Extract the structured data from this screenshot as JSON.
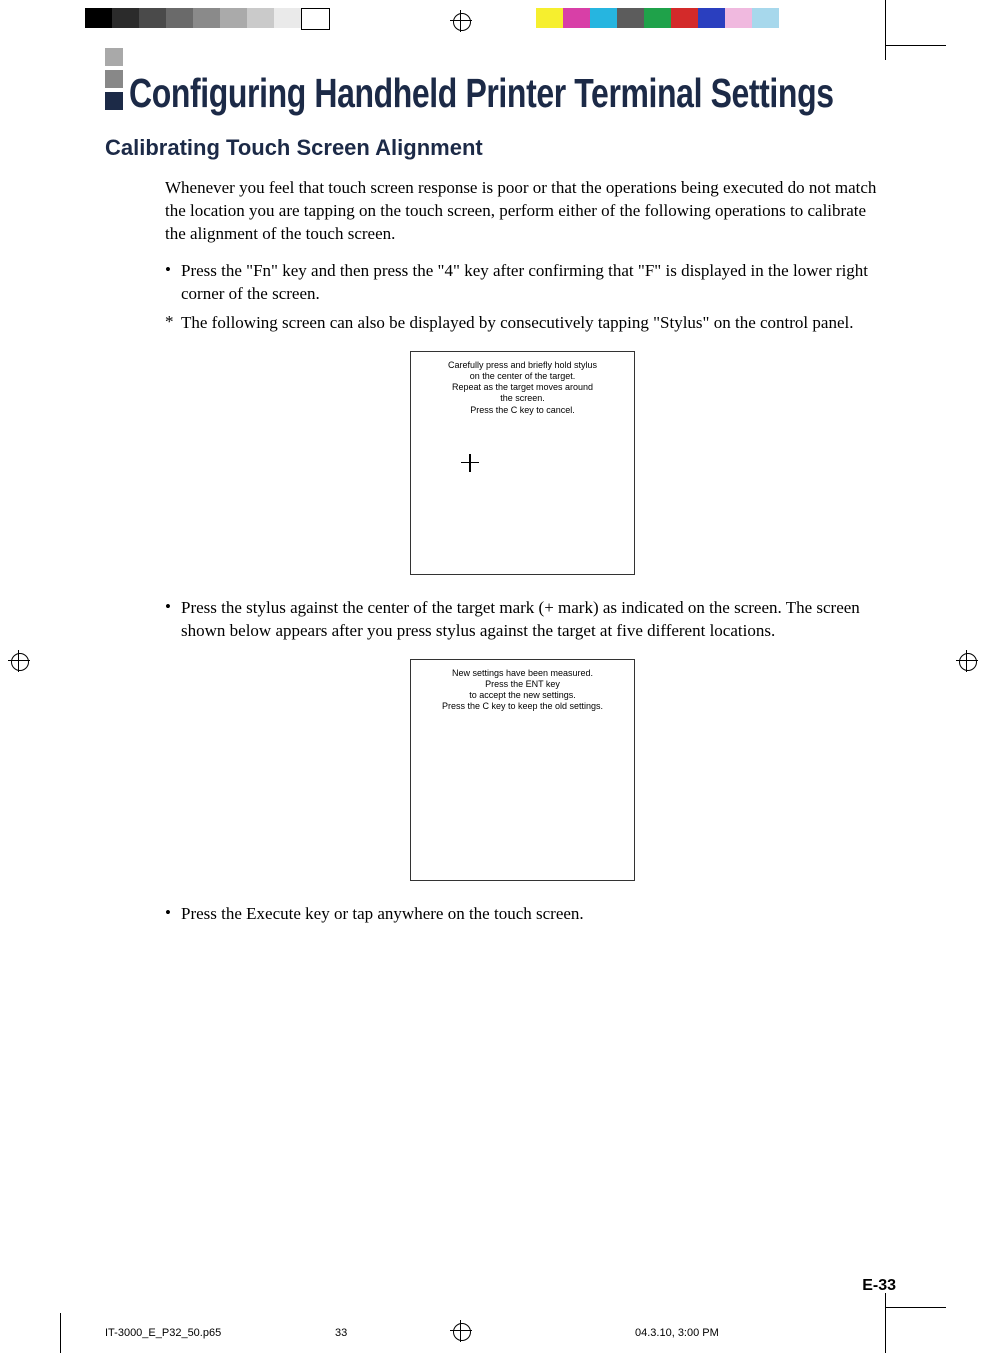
{
  "colorbar_left": [
    "#000000",
    "#2b2b2b",
    "#4a4a4a",
    "#6a6a6a",
    "#8a8a8a",
    "#aaaaaa",
    "#cacaca",
    "#eaeaea",
    "#ffffff"
  ],
  "colorbar_right": [
    "#f6ef2e",
    "#d83fa7",
    "#26b5e0",
    "#5c5c5c",
    "#1fa24a",
    "#d32a2a",
    "#2a3fbf",
    "#f0b9df",
    "#a7d8ec"
  ],
  "title": "Configuring Handheld Printer Terminal Settings",
  "subtitle": "Calibrating Touch Screen Alignment",
  "intro": "Whenever you feel that touch screen response is poor or that the operations being executed do not match the location you are tapping on the touch screen, perform either of the following operations to calibrate the alignment of the touch screen.",
  "bullets": [
    {
      "mark": "•",
      "text": "Press the \"Fn\" key and then press the \"4\" key after confirming that \"F\" is displayed in the lower right corner of the screen."
    },
    {
      "mark": "*",
      "text": "The following screen can also be displayed by consecutively tapping \"Stylus\" on the control panel."
    }
  ],
  "screen1": {
    "l1": "Carefully press and briefly hold stylus",
    "l2": "on the center of the target.",
    "l3": "Repeat as the target moves around",
    "l4": "the screen.",
    "l5": "Press the C key to cancel."
  },
  "bullet2": {
    "mark": "•",
    "text": "Press the stylus against the center of the target mark (+ mark) as indicated on the screen. The screen shown below appears after you press stylus against the target at five different locations."
  },
  "screen2": {
    "l1": "New settings have been measured.",
    "l2": "Press the ENT key",
    "l3": "to accept the new settings.",
    "l4": "Press the C key to keep the old settings."
  },
  "bullet3": {
    "mark": "•",
    "text": "Press the Execute key or tap anywhere on the touch screen."
  },
  "page_number": "E-33",
  "footer": {
    "file": "IT-3000_E_P32_50.p65",
    "sheet": "33",
    "timestamp": "04.3.10, 3:00 PM"
  }
}
